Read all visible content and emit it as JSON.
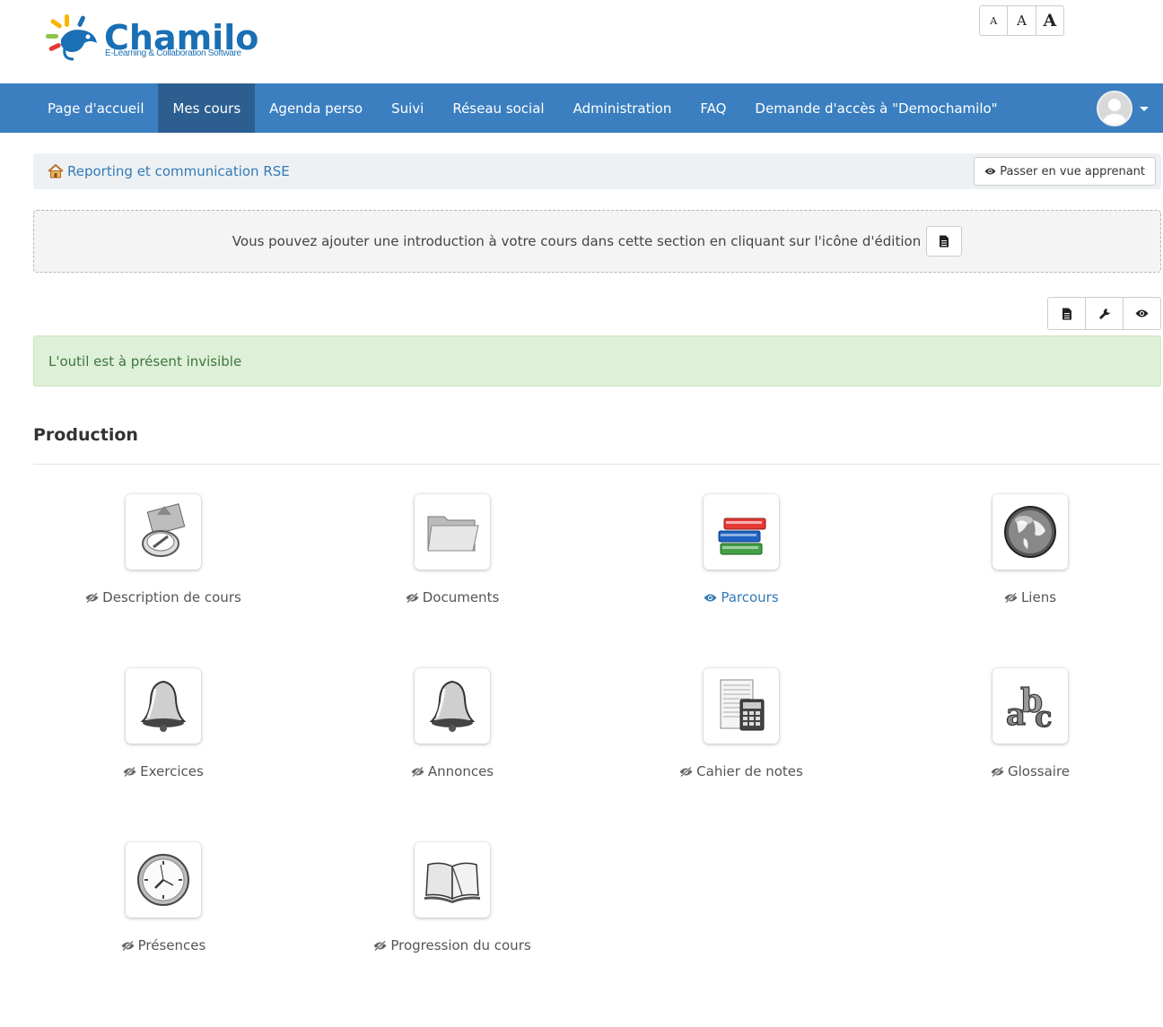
{
  "header": {
    "logo_name": "Chamilo",
    "logo_tagline": "E-Learning & Collaboration Software",
    "font_sizes": [
      "A",
      "A",
      "A"
    ]
  },
  "nav": {
    "items": [
      {
        "label": "Page d'accueil",
        "active": false
      },
      {
        "label": "Mes cours",
        "active": true
      },
      {
        "label": "Agenda perso",
        "active": false
      },
      {
        "label": "Suivi",
        "active": false
      },
      {
        "label": "Réseau social",
        "active": false
      },
      {
        "label": "Administration",
        "active": false
      },
      {
        "label": "FAQ",
        "active": false
      },
      {
        "label": "Demande d'accès à \"Demochamilo\"",
        "active": false
      }
    ]
  },
  "breadcrumb": {
    "course": "Reporting et communication RSE",
    "student_view_label": "Passer en vue apprenant"
  },
  "intro": {
    "text": "Vous pouvez ajouter une introduction à votre cours dans cette section en cliquant sur l'icône d'édition"
  },
  "alert": {
    "text": "L'outil est à présent invisible"
  },
  "section": {
    "title": "Production"
  },
  "tools": [
    {
      "label": "Description de cours",
      "visible": false,
      "icon": "course-description-icon"
    },
    {
      "label": "Documents",
      "visible": false,
      "icon": "folder-icon"
    },
    {
      "label": "Parcours",
      "visible": true,
      "icon": "books-icon"
    },
    {
      "label": "Liens",
      "visible": false,
      "icon": "globe-icon"
    },
    {
      "label": "Exercices",
      "visible": false,
      "icon": "bell-icon"
    },
    {
      "label": "Annonces",
      "visible": false,
      "icon": "bell-icon"
    },
    {
      "label": "Cahier de notes",
      "visible": false,
      "icon": "calculator-icon"
    },
    {
      "label": "Glossaire",
      "visible": false,
      "icon": "abc-icon"
    },
    {
      "label": "Présences",
      "visible": false,
      "icon": "clock-icon"
    },
    {
      "label": "Progression du cours",
      "visible": false,
      "icon": "book-icon"
    }
  ],
  "colors": {
    "brand": "#1a6fb5",
    "navbar": "#3b7fc0",
    "nav_active": "#2c5f90",
    "alert_bg": "#dff0d8",
    "alert_text": "#3c763d",
    "link": "#337ab7"
  }
}
